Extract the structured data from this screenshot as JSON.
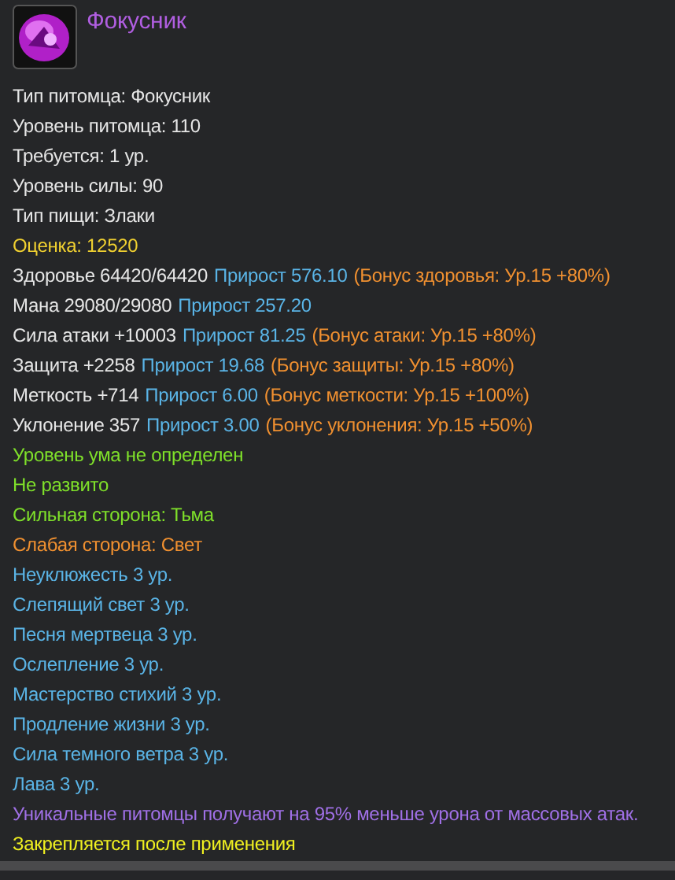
{
  "title": "Фокусник",
  "lines": [
    [
      {
        "text": "Тип питомца: Фокусник",
        "kind": "plain"
      }
    ],
    [
      {
        "text": "Уровень питомца: 110",
        "kind": "plain"
      }
    ],
    [
      {
        "text": "Требуется: 1 ур.",
        "kind": "plain"
      }
    ],
    [
      {
        "text": "Уровень силы: 90",
        "kind": "plain"
      }
    ],
    [
      {
        "text": "Тип пищи: Злаки",
        "kind": "plain"
      }
    ],
    [
      {
        "text": "Оценка: 12520",
        "kind": "gold"
      }
    ],
    [
      {
        "text": "Здоровье 64420/64420",
        "kind": "plain"
      },
      {
        "text": "Прирост 576.10",
        "kind": "gain"
      },
      {
        "text": "(Бонус здоровья: Ур.15 +80%)",
        "kind": "bonus"
      }
    ],
    [
      {
        "text": "Мана 29080/29080",
        "kind": "plain"
      },
      {
        "text": "Прирост 257.20",
        "kind": "gain"
      }
    ],
    [
      {
        "text": "Сила атаки +10003",
        "kind": "plain"
      },
      {
        "text": "Прирост 81.25",
        "kind": "gain"
      },
      {
        "text": "(Бонус атаки: Ур.15 +80%)",
        "kind": "bonus"
      }
    ],
    [
      {
        "text": "Защита +2258",
        "kind": "plain"
      },
      {
        "text": "Прирост 19.68",
        "kind": "gain"
      },
      {
        "text": "(Бонус защиты: Ур.15 +80%)",
        "kind": "bonus"
      }
    ],
    [
      {
        "text": "Меткость +714",
        "kind": "plain"
      },
      {
        "text": "Прирост 6.00",
        "kind": "gain"
      },
      {
        "text": "(Бонус меткости: Ур.15 +100%)",
        "kind": "bonus"
      }
    ],
    [
      {
        "text": "Уклонение 357",
        "kind": "plain"
      },
      {
        "text": "Прирост 3.00",
        "kind": "gain"
      },
      {
        "text": "(Бонус уклонения: Ур.15 +50%)",
        "kind": "bonus"
      }
    ],
    [
      {
        "text": "Уровень ума не определен",
        "kind": "good"
      }
    ],
    [
      {
        "text": "Не развито",
        "kind": "good"
      }
    ],
    [
      {
        "text": "Сильная сторона:  Тьма",
        "kind": "good"
      }
    ],
    [
      {
        "text": "Слабая сторона:  Свет",
        "kind": "bonus"
      }
    ],
    [
      {
        "text": "Неуклюжесть 3 ур.",
        "kind": "gain"
      }
    ],
    [
      {
        "text": "Слепящий свет 3 ур.",
        "kind": "gain"
      }
    ],
    [
      {
        "text": "Песня мертвеца 3 ур.",
        "kind": "gain"
      }
    ],
    [
      {
        "text": "Ослепление 3 ур.",
        "kind": "gain"
      }
    ],
    [
      {
        "text": "Мастерство стихий 3 ур.",
        "kind": "gain"
      }
    ],
    [
      {
        "text": "Продление жизни 3 ур.",
        "kind": "gain"
      }
    ],
    [
      {
        "text": "Сила темного ветра 3 ур.",
        "kind": "gain"
      }
    ],
    [
      {
        "text": "Лава 3 ур.",
        "kind": "gain"
      }
    ],
    [
      {
        "text": "Уникальные питомцы получают на 95% меньше урона от массовых атак.",
        "kind": "rare"
      }
    ],
    [
      {
        "text": "Закрепляется после применения",
        "kind": "note"
      }
    ]
  ]
}
